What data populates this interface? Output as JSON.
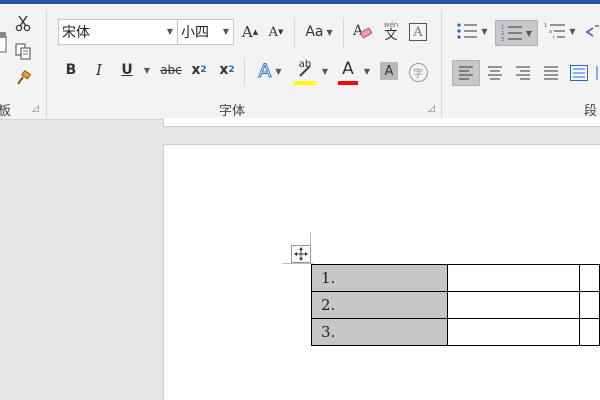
{
  "colors": {
    "title_bar": "#2b579a",
    "highlight_yellow": "#ffff00",
    "font_red": "#ff0000",
    "cell_shading": "#c6c6c6"
  },
  "ribbon": {
    "clipboard": {
      "label": "板",
      "icons": [
        "cut-icon",
        "copy-icon",
        "format-painter-icon"
      ]
    },
    "font": {
      "label": "字体",
      "font_name": "宋体",
      "font_size": "小四",
      "grow_font": "A",
      "shrink_font": "A",
      "change_case": "Aa",
      "phonetic_top": "wén",
      "phonetic_bottom": "文",
      "char_border": "A",
      "bold": "B",
      "italic": "I",
      "underline": "U",
      "strikethrough": "abc",
      "subscript_base": "x",
      "subscript": "2",
      "superscript_base": "x",
      "superscript": "2",
      "text_effects": "A",
      "highlight": "ab",
      "font_color": "A",
      "char_shading": "A",
      "enclose": "字"
    },
    "paragraph": {
      "label": "段"
    }
  },
  "document": {
    "table": {
      "rows": [
        [
          "1.",
          "",
          ""
        ],
        [
          "2.",
          "",
          ""
        ],
        [
          "3.",
          "",
          ""
        ]
      ]
    }
  }
}
